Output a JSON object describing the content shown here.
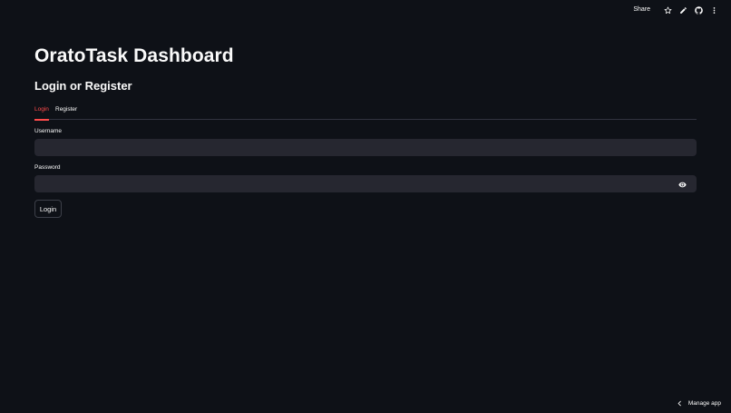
{
  "toolbar": {
    "share_label": "Share",
    "icons": [
      "star-icon",
      "pencil-icon",
      "github-icon",
      "more-vertical-icon"
    ]
  },
  "app": {
    "title": "OratoTask Dashboard",
    "subtitle": "Login or Register"
  },
  "tabs": [
    {
      "label": "Login",
      "active": true
    },
    {
      "label": "Register",
      "active": false
    }
  ],
  "form": {
    "username_label": "Username",
    "username_value": "",
    "password_label": "Password",
    "password_value": "",
    "submit_label": "Login"
  },
  "footer": {
    "manage_label": "Manage app"
  },
  "colors": {
    "background": "#0e1117",
    "input_bg": "#262730",
    "accent": "#ff4b4b",
    "text": "#fafafa"
  }
}
